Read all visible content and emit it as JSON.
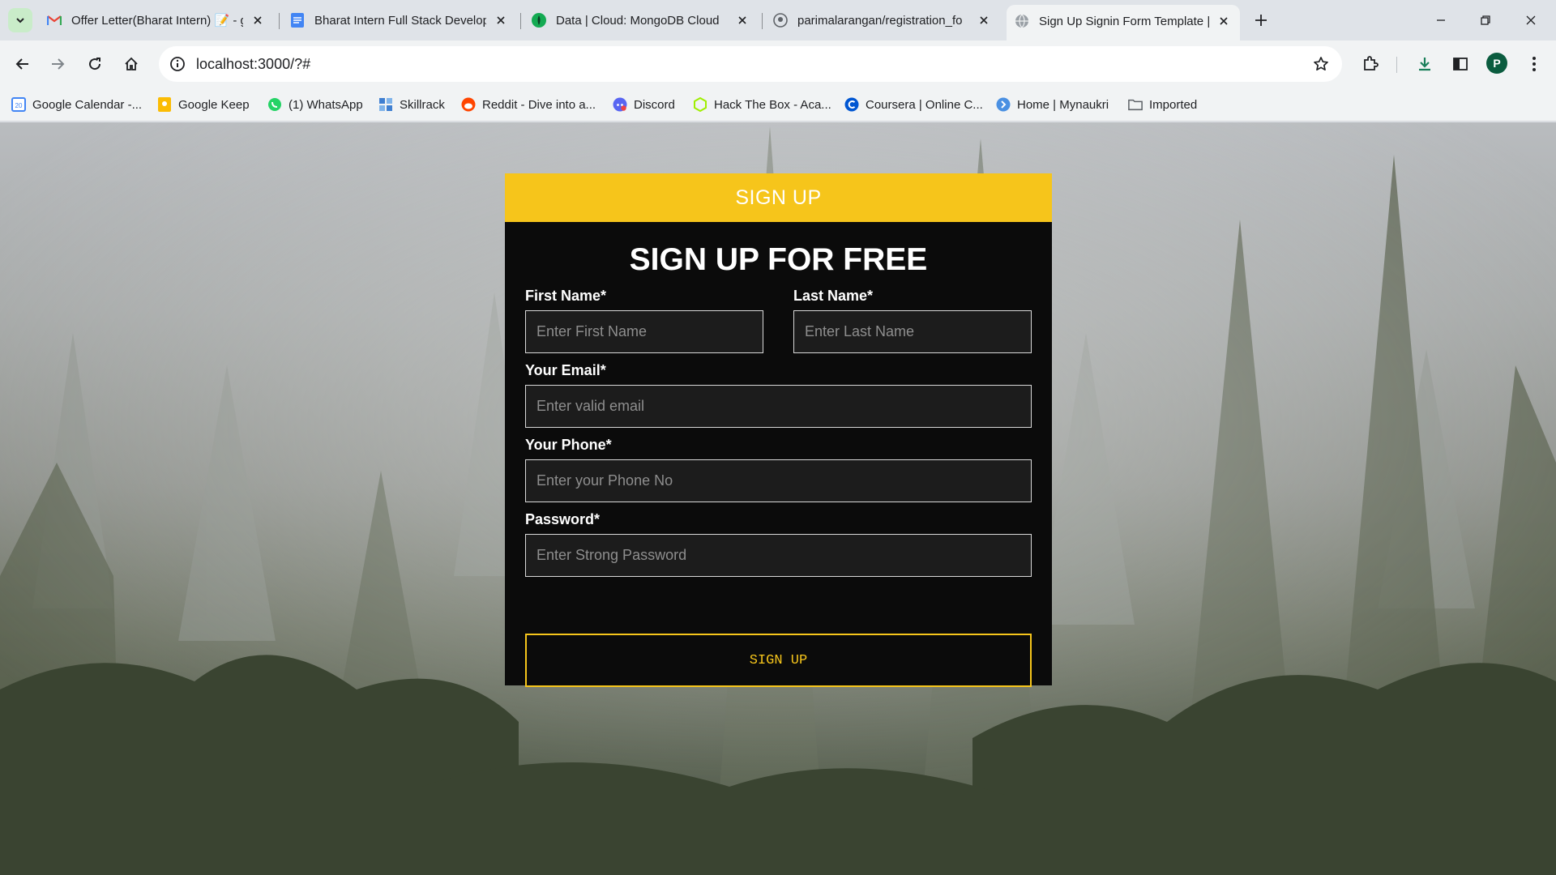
{
  "browser": {
    "tabs": [
      {
        "title": "Offer Letter(Bharat Intern) 📝 - g",
        "favicon": "gmail-icon",
        "active": false
      },
      {
        "title": "Bharat Intern Full Stack Develop",
        "favicon": "google-docs-icon",
        "active": false
      },
      {
        "title": "Data | Cloud: MongoDB Cloud",
        "favicon": "mongodb-icon",
        "active": false
      },
      {
        "title": "parimalarangan/registration_fo",
        "favicon": "github-icon",
        "active": false
      },
      {
        "title": "Sign Up Signin Form Template |",
        "favicon": "globe-icon",
        "active": true
      }
    ],
    "url": "localhost:3000/?#",
    "profile_initial": "P",
    "bookmarks": [
      {
        "label": "Google Calendar -...",
        "icon": "calendar-icon",
        "color": "#4285f4"
      },
      {
        "label": "Google Keep",
        "icon": "keep-icon",
        "color": "#fbbc04"
      },
      {
        "label": "(1) WhatsApp",
        "icon": "whatsapp-icon",
        "color": "#25d366"
      },
      {
        "label": "Skillrack",
        "icon": "skillrack-icon",
        "color": "#3f7fd1"
      },
      {
        "label": "Reddit - Dive into a...",
        "icon": "reddit-icon",
        "color": "#ff4500"
      },
      {
        "label": "Discord",
        "icon": "discord-icon",
        "color": "#5865f2"
      },
      {
        "label": "Hack The Box - Aca...",
        "icon": "hackthebox-icon",
        "color": "#9fef00"
      },
      {
        "label": "Coursera | Online C...",
        "icon": "coursera-icon",
        "color": "#0056d2"
      },
      {
        "label": "Home | Mynaukri",
        "icon": "naukri-icon",
        "color": "#4a90e2"
      },
      {
        "label": "Imported",
        "icon": "folder-icon",
        "color": "#5f6368"
      }
    ]
  },
  "form": {
    "header": "SIGN UP",
    "title": "SIGN UP FOR FREE",
    "first_name_label": "First Name*",
    "first_name_placeholder": "Enter First Name",
    "last_name_label": "Last Name*",
    "last_name_placeholder": "Enter Last Name",
    "email_label": "Your Email*",
    "email_placeholder": "Enter valid email",
    "phone_label": "Your Phone*",
    "phone_placeholder": "Enter your Phone No",
    "password_label": "Password*",
    "password_placeholder": "Enter Strong Password",
    "submit_label": "SIGN UP"
  },
  "colors": {
    "accent": "#f6c51b",
    "card_background": "#0b0b0b"
  }
}
